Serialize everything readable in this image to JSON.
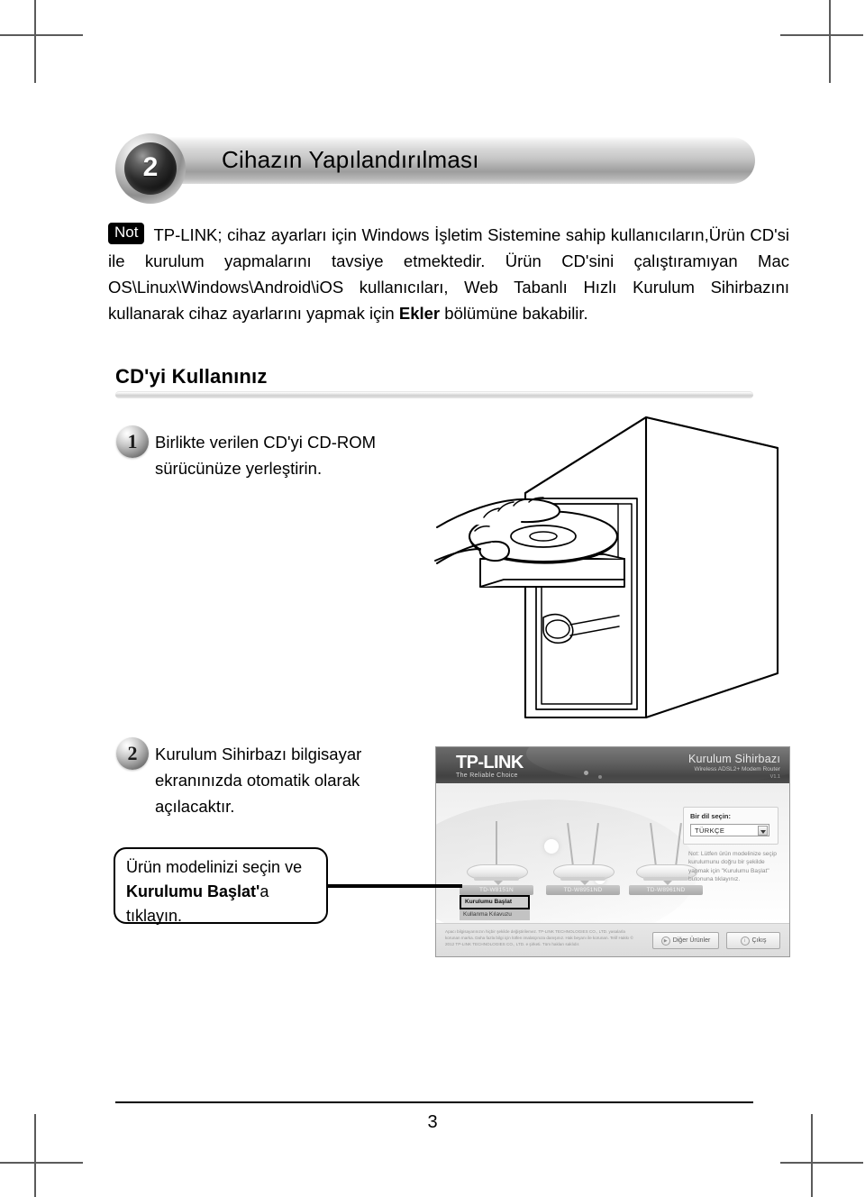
{
  "section": {
    "number": "2",
    "title": "Cihazın Yapılandırılması"
  },
  "note": {
    "badge": "Not",
    "text_part1": "TP-LINK; cihaz ayarları için Windows İşletim Sistemine sahip kullanıcıların,Ürün CD'si ile kurulum yapmalarını tavsiye etmektedir. Ürün CD'sini çalıştıramıyan Mac OS\\Linux\\Windows\\Android\\iOS kullanıcıları, Web Tabanlı Hızlı Kurulum Sihirbazını kullanarak cihaz ayarlarını yapmak için ",
    "text_bold": "Ekler",
    "text_part2": " bölümüne bakabilir."
  },
  "cd_section": {
    "heading": "CD'yi Kullanınız"
  },
  "steps": [
    {
      "number": "1",
      "text": "Birlikte verilen CD'yi CD-ROM sürücünüze yerleştirin."
    },
    {
      "number": "2",
      "text": "Kurulum Sihirbazı bilgisayar ekranınızda otomatik olarak açılacaktır."
    }
  ],
  "callout": {
    "line1": "Ürün modelinizi seçin ve ",
    "bold": "Kurulumu Başlat'",
    "line2": "a tıklayın."
  },
  "wizard": {
    "brand_name": "TP-LINK",
    "brand_tagline": "The Reliable Choice",
    "title": "Kurulum Sihirbazı",
    "subtitle": "Wireless ADSL2+ Modem Router",
    "version": "V1.1",
    "language_label": "Bir dil seçin:",
    "language_value": "TÜRKÇE",
    "language_note": "Not: Lütfen ürün modelinize seçip kurulumunu doğru bir şekilde yapmak için \"Kurulumu Başlat\" butonuna tıklayınız.",
    "routers": [
      {
        "model": "TD-W8151N"
      },
      {
        "model": "TD-W8951ND"
      },
      {
        "model": "TD-W8961ND"
      }
    ],
    "start_menu": [
      {
        "label": "Kurulumu Başlat",
        "selected": true
      },
      {
        "label": "Kullanma Kılavuzu",
        "selected": false
      }
    ],
    "legal": "Apacı bilgisayarınızın hiçbir şekilde değiştirilemez. TP-LINK TECHNOLOGIES CO., LTD. yasalarla korunan marka. Daha fazla bilgi için lütfen imalatçınıza danışınız. Hak beyanı ile korunan. Telif Hakkı © 2012 TP-LINK TECHNOLOGIES CO., LTD. e şirketi. Tüm hakları saklıdır.",
    "buttons": [
      {
        "label": "Diğer Ürünler",
        "icon": "arrow-icon"
      },
      {
        "label": "Çıkış",
        "icon": "info-icon"
      }
    ]
  },
  "footer": {
    "page_number": "3"
  }
}
